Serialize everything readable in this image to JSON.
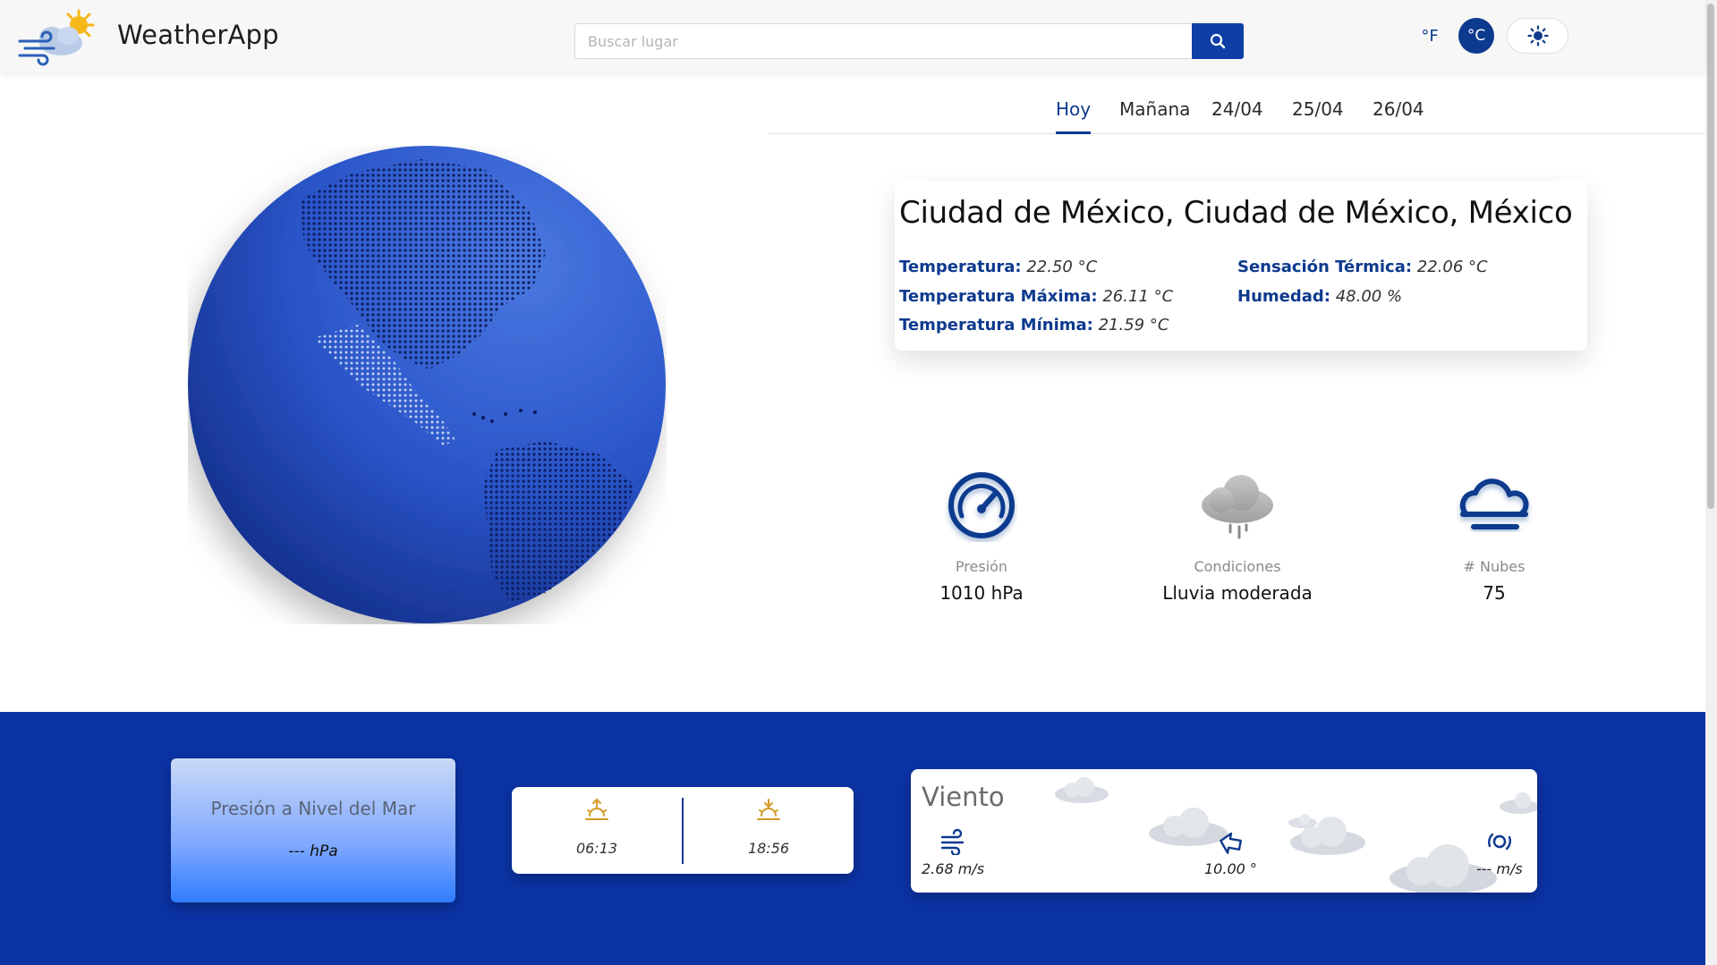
{
  "app": {
    "name": "WeatherApp"
  },
  "header": {
    "search_placeholder": "Buscar lugar",
    "unit_f": "°F",
    "unit_c": "°C",
    "active_unit": "°C"
  },
  "tabs": [
    {
      "label": "Hoy",
      "active": true
    },
    {
      "label": "Mañana",
      "active": false
    },
    {
      "label": "24/04",
      "active": false
    },
    {
      "label": "25/04",
      "active": false
    },
    {
      "label": "26/04",
      "active": false
    }
  ],
  "location": {
    "title": "Ciudad de México, Ciudad de México, México",
    "stats": {
      "temp": {
        "label": "Temperatura:",
        "value": "22.50 °C"
      },
      "temp_max": {
        "label": "Temperatura Máxima:",
        "value": "26.11 °C"
      },
      "temp_min": {
        "label": "Temperatura Mínima:",
        "value": "21.59 °C"
      },
      "feels_like": {
        "label": "Sensación Térmica:",
        "value": "22.06 °C"
      },
      "humidity": {
        "label": "Humedad:",
        "value": "48.00 %"
      }
    }
  },
  "metrics": {
    "pressure": {
      "label": "Presión",
      "value": "1010 hPa",
      "icon": "gauge-icon"
    },
    "conditions": {
      "label": "Condiciones",
      "value": "Lluvia moderada",
      "icon": "rain-cloud-icon"
    },
    "clouds": {
      "label": "# Nubes",
      "value": "75",
      "icon": "fog-cloud-icon"
    }
  },
  "sea_level": {
    "title": "Presión a Nivel del Mar",
    "value": "--- hPa"
  },
  "sun": {
    "sunrise": "06:13",
    "sunset": "18:56"
  },
  "wind": {
    "title": "Viento",
    "speed": "2.68 m/s",
    "direction": "10.00 °",
    "gust": "--- m/s"
  },
  "colors": {
    "primary": "#0d3a8e",
    "bottom_band": "#0b33a4",
    "globe": "#2a55c9",
    "sun_icon": "#d39a26"
  }
}
